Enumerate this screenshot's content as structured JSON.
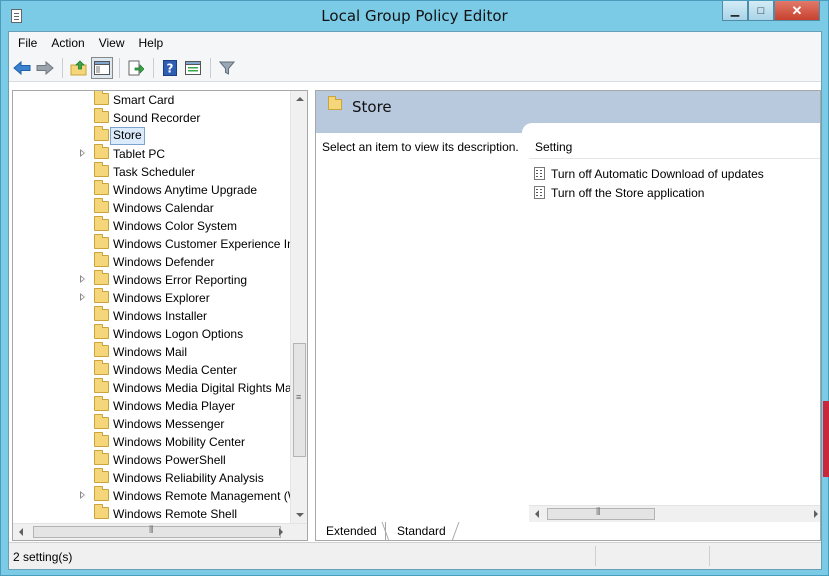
{
  "window": {
    "title": "Local Group Policy Editor",
    "caption_buttons": {
      "minimize": "▁",
      "maximize": "□",
      "close": "✕"
    }
  },
  "menu": [
    "File",
    "Action",
    "View",
    "Help"
  ],
  "toolbar": {
    "buttons": [
      {
        "name": "back-button",
        "icon": "arrow-left-icon"
      },
      {
        "name": "forward-button",
        "icon": "arrow-right-icon"
      },
      {
        "name": "up-one-level-button",
        "icon": "folder-up-icon"
      },
      {
        "name": "show-hide-console-tree-button",
        "icon": "console-tree-icon",
        "pressed": true
      },
      {
        "name": "export-list-button",
        "icon": "export-list-icon"
      },
      {
        "name": "help-button",
        "icon": "help-icon"
      },
      {
        "name": "properties-button",
        "icon": "properties-icon"
      },
      {
        "name": "filter-button",
        "icon": "filter-icon"
      }
    ]
  },
  "tree": {
    "items": [
      {
        "label": "Smart Card",
        "expandable": false,
        "selected": false
      },
      {
        "label": "Sound Recorder",
        "expandable": false,
        "selected": false
      },
      {
        "label": "Store",
        "expandable": false,
        "selected": true
      },
      {
        "label": "Tablet PC",
        "expandable": true,
        "selected": false
      },
      {
        "label": "Task Scheduler",
        "expandable": false,
        "selected": false
      },
      {
        "label": "Windows Anytime Upgrade",
        "expandable": false,
        "selected": false
      },
      {
        "label": "Windows Calendar",
        "expandable": false,
        "selected": false
      },
      {
        "label": "Windows Color System",
        "expandable": false,
        "selected": false
      },
      {
        "label": "Windows Customer Experience Im",
        "expandable": false,
        "selected": false
      },
      {
        "label": "Windows Defender",
        "expandable": false,
        "selected": false
      },
      {
        "label": "Windows Error Reporting",
        "expandable": true,
        "selected": false
      },
      {
        "label": "Windows Explorer",
        "expandable": true,
        "selected": false
      },
      {
        "label": "Windows Installer",
        "expandable": false,
        "selected": false
      },
      {
        "label": "Windows Logon Options",
        "expandable": false,
        "selected": false
      },
      {
        "label": "Windows Mail",
        "expandable": false,
        "selected": false
      },
      {
        "label": "Windows Media Center",
        "expandable": false,
        "selected": false
      },
      {
        "label": "Windows Media Digital Rights Ma",
        "expandable": false,
        "selected": false
      },
      {
        "label": "Windows Media Player",
        "expandable": false,
        "selected": false
      },
      {
        "label": "Windows Messenger",
        "expandable": false,
        "selected": false
      },
      {
        "label": "Windows Mobility Center",
        "expandable": false,
        "selected": false
      },
      {
        "label": "Windows PowerShell",
        "expandable": false,
        "selected": false
      },
      {
        "label": "Windows Reliability Analysis",
        "expandable": false,
        "selected": false
      },
      {
        "label": "Windows Remote Management (W",
        "expandable": true,
        "selected": false
      },
      {
        "label": "Windows Remote Shell",
        "expandable": false,
        "selected": false
      }
    ]
  },
  "right_pane": {
    "header_title": "Store",
    "description_text": "Select an item to view its description.",
    "column_header": "Setting",
    "settings": [
      {
        "label": "Turn off Automatic Download of updates",
        "icon": "policy-setting-icon"
      },
      {
        "label": "Turn off the Store application",
        "icon": "policy-setting-icon"
      }
    ]
  },
  "view_tabs": [
    {
      "label": "Extended",
      "active": true
    },
    {
      "label": "Standard",
      "active": false
    }
  ],
  "status": {
    "text": "2 setting(s)"
  }
}
